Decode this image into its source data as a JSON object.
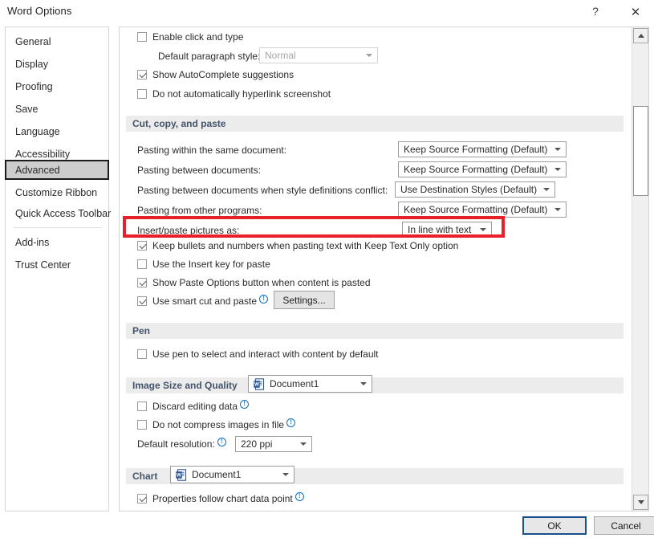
{
  "window": {
    "title": "Word Options",
    "help_icon": "question-mark-icon",
    "close_icon": "close-icon"
  },
  "sidebar": {
    "items": [
      {
        "label": "General",
        "selected": false
      },
      {
        "label": "Display",
        "selected": false
      },
      {
        "label": "Proofing",
        "selected": false
      },
      {
        "label": "Save",
        "selected": false
      },
      {
        "label": "Language",
        "selected": false
      },
      {
        "label": "Accessibility",
        "selected": false
      },
      {
        "label": "Advanced",
        "selected": true
      },
      {
        "label": "Customize Ribbon",
        "selected": false
      },
      {
        "label": "Quick Access Toolbar",
        "selected": false
      },
      {
        "label": "Add-ins",
        "selected": false
      },
      {
        "label": "Trust Center",
        "selected": false
      }
    ]
  },
  "content": {
    "editing_top": {
      "enable_click_and_type": {
        "label": "Enable click and type",
        "checked": false
      },
      "default_paragraph_style_label": "Default paragraph style:",
      "default_paragraph_style_value": "Normal",
      "show_autocomplete": {
        "label": "Show AutoComplete suggestions",
        "checked": true
      },
      "no_auto_hyperlink": {
        "label": "Do not automatically hyperlink screenshot",
        "checked": false
      }
    },
    "cut_copy_paste": {
      "heading": "Cut, copy, and paste",
      "rows": [
        {
          "label": "Pasting within the same document:",
          "value": "Keep Source Formatting (Default)"
        },
        {
          "label": "Pasting between documents:",
          "value": "Keep Source Formatting (Default)"
        },
        {
          "label": "Pasting between documents when style definitions conflict:",
          "value": "Use Destination Styles (Default)"
        },
        {
          "label": "Pasting from other programs:",
          "value": "Keep Source Formatting (Default)"
        }
      ],
      "insert_paste_pictures": {
        "label": "Insert/paste pictures as:",
        "value": "In line with text",
        "highlighted": true,
        "highlight_color": "#e8202a"
      },
      "checkboxes": [
        {
          "label": "Keep bullets and numbers when pasting text with Keep Text Only option",
          "checked": true
        },
        {
          "label": "Use the Insert key for paste",
          "checked": false
        },
        {
          "label": "Show Paste Options button when content is pasted",
          "checked": true
        }
      ],
      "smart_cut_paste": {
        "label": "Use smart cut and paste",
        "checked": true,
        "has_info": true
      },
      "settings_button": "Settings..."
    },
    "pen": {
      "heading": "Pen",
      "use_pen": {
        "label": "Use pen to select and interact with content by default",
        "checked": false
      }
    },
    "image_size_quality": {
      "heading": "Image Size and Quality",
      "scope_value": "Document1",
      "scope_icon": "word-document-icon",
      "discard_editing_data": {
        "label": "Discard editing data",
        "checked": false,
        "has_info": true
      },
      "do_not_compress": {
        "label": "Do not compress images in file",
        "checked": false,
        "has_info": true
      },
      "default_resolution_label": "Default resolution:",
      "default_resolution_value": "220 ppi"
    },
    "chart": {
      "heading": "Chart",
      "scope_value": "Document1",
      "scope_icon": "word-document-icon",
      "properties_follow": {
        "label": "Properties follow chart data point",
        "checked": true,
        "has_info": true
      }
    }
  },
  "scrollbar": {
    "up_icon": "triangle-up-icon",
    "down_icon": "triangle-down-icon"
  },
  "footer": {
    "ok_label": "OK",
    "cancel_label": "Cancel"
  }
}
